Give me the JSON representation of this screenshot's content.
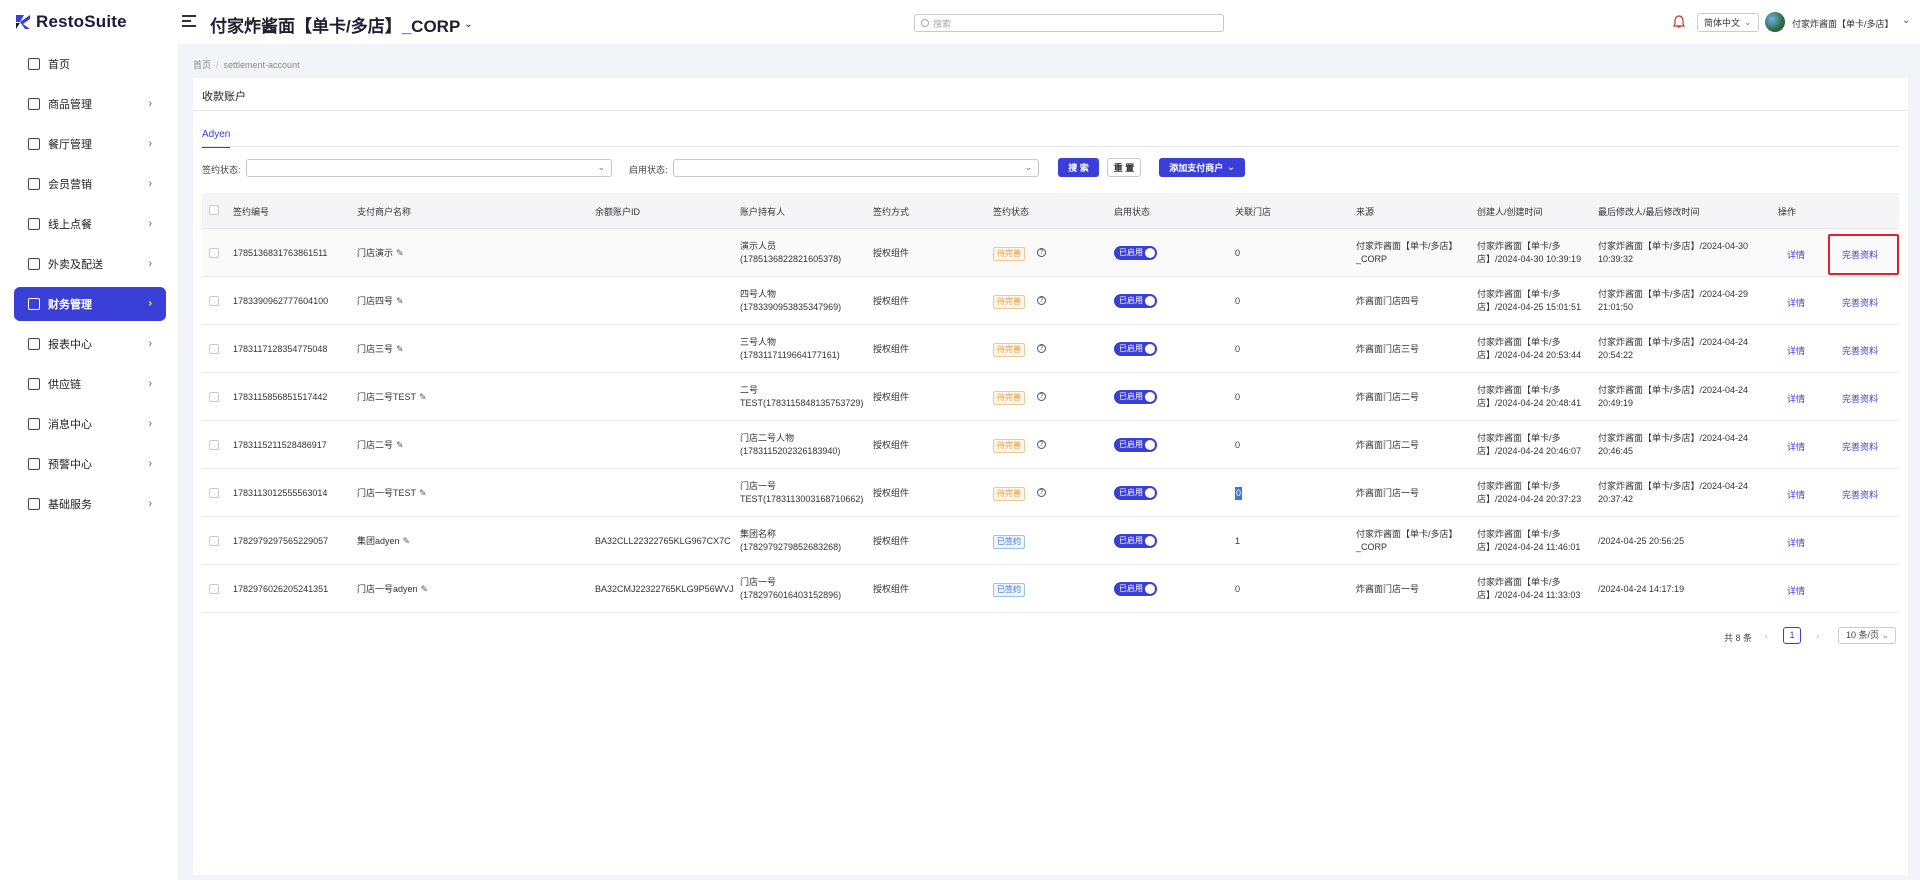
{
  "brand": {
    "name": "RestoSuite",
    "accent": "#3a3fd8"
  },
  "header": {
    "store_name": "付家炸酱面【单卡/多店】_CORP",
    "search_placeholder": "搜索",
    "language": "简体中文",
    "user_name": "付家炸酱面【单卡/多店】"
  },
  "sidebar": {
    "items": [
      {
        "label": "首页",
        "icon": "home-icon"
      },
      {
        "label": "商品管理",
        "icon": "product-icon"
      },
      {
        "label": "餐厅管理",
        "icon": "restaurant-icon"
      },
      {
        "label": "会员营销",
        "icon": "member-icon"
      },
      {
        "label": "线上点餐",
        "icon": "online-order-icon"
      },
      {
        "label": "外卖及配送",
        "icon": "delivery-icon"
      },
      {
        "label": "财务管理",
        "icon": "finance-icon"
      },
      {
        "label": "报表中心",
        "icon": "report-icon"
      },
      {
        "label": "供应链",
        "icon": "supply-icon"
      },
      {
        "label": "消息中心",
        "icon": "message-icon"
      },
      {
        "label": "预警中心",
        "icon": "alert-icon"
      },
      {
        "label": "基础服务",
        "icon": "grid-icon"
      }
    ],
    "active": "财务管理"
  },
  "breadcrumb": {
    "home": "首页",
    "current": "settlement-account"
  },
  "page": {
    "title": "收款账户",
    "tab": "Adyen",
    "filters": {
      "sign_status_label": "签约状态:",
      "enable_status_label": "启用状态:"
    },
    "buttons": {
      "search": "搜 索",
      "reset": "重 置",
      "add": "添加支付商户"
    }
  },
  "table": {
    "headers": [
      "签约编号",
      "支付商户名称",
      "余额账户ID",
      "账户持有人",
      "签约方式",
      "签约状态",
      "启用状态",
      "关联门店",
      "来源",
      "创建人/创建时间",
      "最后修改人/最后修改时间",
      "操作"
    ],
    "rows": [
      {
        "id": "1785136831763861511",
        "merchant": "门店演示",
        "balance_id": "",
        "holder1": "演示人员",
        "holder2": "(1785136822821605378)",
        "method": "授权组件",
        "sign_status": "待完善",
        "enabled": "已启用",
        "stores": "0",
        "source1": "付家炸酱面【单卡/多店】",
        "source2": "_CORP",
        "created1": "付家炸酱面【单卡/多",
        "created2": "店】/2024-04-30 10:39:19",
        "modified1": "付家炸酱面【单卡/多店】/2024-04-30",
        "modified2": "10:39:32",
        "op1": "详情",
        "op2": "完善资料"
      },
      {
        "id": "1783390962777604100",
        "merchant": "门店四号",
        "balance_id": "",
        "holder1": "四号人物",
        "holder2": "(1783390953835347969)",
        "method": "授权组件",
        "sign_status": "待完善",
        "enabled": "已启用",
        "stores": "0",
        "source1": "炸酱面门店四号",
        "source2": "",
        "created1": "付家炸酱面【单卡/多",
        "created2": "店】/2024-04-25 15:01:51",
        "modified1": "付家炸酱面【单卡/多店】/2024-04-29",
        "modified2": "21:01:50",
        "op1": "详情",
        "op2": "完善资料"
      },
      {
        "id": "1783117128354775048",
        "merchant": "门店三号",
        "balance_id": "",
        "holder1": "三号人物",
        "holder2": "(1783117119664177161)",
        "method": "授权组件",
        "sign_status": "待完善",
        "enabled": "已启用",
        "stores": "0",
        "source1": "炸酱面门店三号",
        "source2": "",
        "created1": "付家炸酱面【单卡/多",
        "created2": "店】/2024-04-24 20:53:44",
        "modified1": "付家炸酱面【单卡/多店】/2024-04-24",
        "modified2": "20:54:22",
        "op1": "详情",
        "op2": "完善资料"
      },
      {
        "id": "1783115856851517442",
        "merchant": "门店二号TEST",
        "balance_id": "",
        "holder1": "二号",
        "holder2": "TEST(1783115848135753729)",
        "method": "授权组件",
        "sign_status": "待完善",
        "enabled": "已启用",
        "stores": "0",
        "source1": "炸酱面门店二号",
        "source2": "",
        "created1": "付家炸酱面【单卡/多",
        "created2": "店】/2024-04-24 20:48:41",
        "modified1": "付家炸酱面【单卡/多店】/2024-04-24",
        "modified2": "20:49:19",
        "op1": "详情",
        "op2": "完善资料"
      },
      {
        "id": "1783115211528486917",
        "merchant": "门店二号",
        "balance_id": "",
        "holder1": "门店二号人物",
        "holder2": "(1783115202326183940)",
        "method": "授权组件",
        "sign_status": "待完善",
        "enabled": "已启用",
        "stores": "0",
        "source1": "炸酱面门店二号",
        "source2": "",
        "created1": "付家炸酱面【单卡/多",
        "created2": "店】/2024-04-24 20:46:07",
        "modified1": "付家炸酱面【单卡/多店】/2024-04-24",
        "modified2": "20:46:45",
        "op1": "详情",
        "op2": "完善资料"
      },
      {
        "id": "1783113012555563014",
        "merchant": "门店一号TEST",
        "balance_id": "",
        "holder1": "门店一号",
        "holder2": "TEST(1783113003168710662)",
        "method": "授权组件",
        "sign_status": "待完善",
        "enabled": "已启用",
        "stores": "0",
        "source1": "炸酱面门店一号",
        "source2": "",
        "created1": "付家炸酱面【单卡/多",
        "created2": "店】/2024-04-24 20:37:23",
        "modified1": "付家炸酱面【单卡/多店】/2024-04-24",
        "modified2": "20:37:42",
        "op1": "详情",
        "op2": "完善资料"
      },
      {
        "id": "1782979297565229057",
        "merchant": "集团adyen",
        "balance_id": "BA32CLL22322765KLG967CX7C",
        "holder1": "集团名称",
        "holder2": "(1782979279852683268)",
        "method": "授权组件",
        "sign_status": "已签约",
        "enabled": "已启用",
        "stores": "1",
        "source1": "付家炸酱面【单卡/多店】",
        "source2": "_CORP",
        "created1": "付家炸酱面【单卡/多",
        "created2": "店】/2024-04-24 11:46:01",
        "modified1": "/2024-04-25 20:56:25",
        "modified2": "",
        "op1": "详情",
        "op2": ""
      },
      {
        "id": "1782976026205241351",
        "merchant": "门店一号adyen",
        "balance_id": "BA32CMJ22322765KLG9P56WVJ",
        "holder1": "门店一号",
        "holder2": "(1782976016403152896)",
        "method": "授权组件",
        "sign_status": "已签约",
        "enabled": "已启用",
        "stores": "0",
        "source1": "炸酱面门店一号",
        "source2": "",
        "created1": "付家炸酱面【单卡/多",
        "created2": "店】/2024-04-24 11:33:03",
        "modified1": "/2024-04-24 14:17:19",
        "modified2": "",
        "op1": "详情",
        "op2": ""
      }
    ]
  },
  "pagination": {
    "total": "共 8 条",
    "page": "1",
    "page_size": "10 条/页"
  }
}
